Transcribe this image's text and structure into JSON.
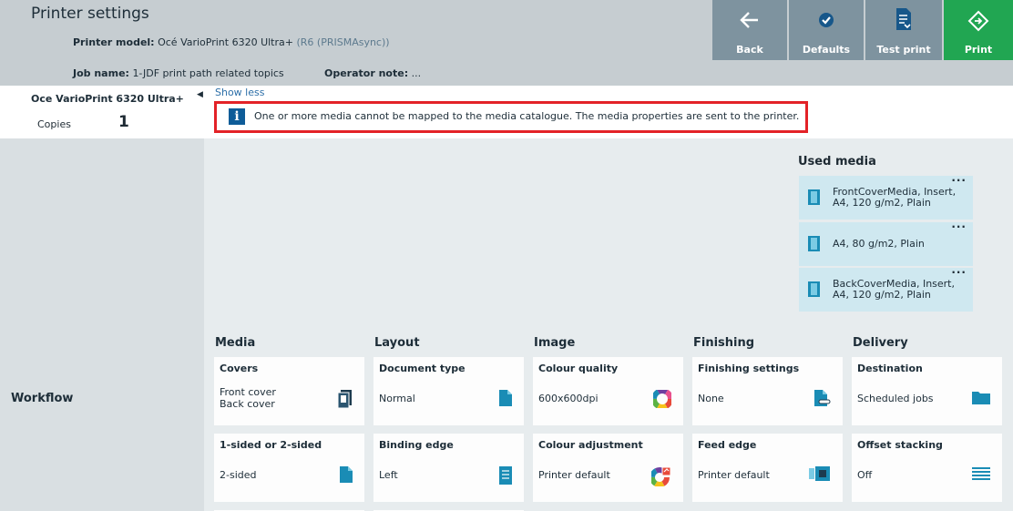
{
  "header": {
    "title": "Printer settings",
    "model_label": "Printer model:",
    "model_value": "Océ VarioPrint 6320 Ultra+",
    "model_detail": "(R6 (PRISMAsync))",
    "job_label": "Job name:",
    "job_value": "1-JDF print path related topics",
    "note_label": "Operator note:",
    "note_value": "..."
  },
  "toolbar": {
    "back": "Back",
    "defaults": "Defaults",
    "test_print": "Test print",
    "print": "Print"
  },
  "left": {
    "printer_name": "Oce VarioPrint 6320 Ultra+",
    "copies_label": "Copies",
    "copies_value": "1",
    "workflow": "Workflow"
  },
  "main": {
    "show_less": "Show less",
    "info_message": "One or more media cannot be mapped to the media catalogue. The media properties are sent to the printer.",
    "used_media_title": "Used media",
    "used_media": [
      {
        "line1": "FrontCoverMedia, Insert,",
        "line2": "A4, 120 g/m2, Plain"
      },
      {
        "line1": "A4, 80 g/m2, Plain",
        "line2": ""
      },
      {
        "line1": "BackCoverMedia, Insert,",
        "line2": "A4, 120 g/m2, Plain"
      }
    ],
    "more_dots": "...",
    "columns": [
      {
        "heading": "Media",
        "tiles": [
          {
            "title": "Covers",
            "value1": "Front cover",
            "value2": "Back cover",
            "icon": "covers-icon"
          },
          {
            "title": "1-sided or 2-sided",
            "value1": "2-sided",
            "value2": "",
            "icon": "sided-icon"
          }
        ]
      },
      {
        "heading": "Layout",
        "tiles": [
          {
            "title": "Document type",
            "value1": "Normal",
            "value2": "",
            "icon": "document-icon"
          },
          {
            "title": "Binding edge",
            "value1": "Left",
            "value2": "",
            "icon": "binding-edge-icon"
          }
        ]
      },
      {
        "heading": "Image",
        "tiles": [
          {
            "title": "Colour quality",
            "value1": "600x600dpi",
            "value2": "",
            "icon": "color-wheel-icon"
          },
          {
            "title": "Colour adjustment",
            "value1": "Printer default",
            "value2": "",
            "icon": "color-adjust-icon"
          }
        ]
      },
      {
        "heading": "Finishing",
        "tiles": [
          {
            "title": "Finishing settings",
            "value1": "None",
            "value2": "",
            "icon": "finishing-icon"
          },
          {
            "title": "Feed edge",
            "value1": "Printer default",
            "value2": "",
            "icon": "feed-edge-icon"
          }
        ]
      },
      {
        "heading": "Delivery",
        "tiles": [
          {
            "title": "Destination",
            "value1": "Scheduled jobs",
            "value2": "",
            "icon": "folder-icon"
          },
          {
            "title": "Offset stacking",
            "value1": "Off",
            "value2": "",
            "icon": "offset-stacking-icon"
          }
        ]
      }
    ]
  },
  "colors": {
    "header_bg": "#c6cdd1",
    "toolbar_button": "#7e939f",
    "print_button": "#21a652",
    "info_border": "#e32227",
    "info_icon": "#0e5c98",
    "media_card": "#cfe8f0",
    "accent_blue": "#1a8cb5"
  }
}
